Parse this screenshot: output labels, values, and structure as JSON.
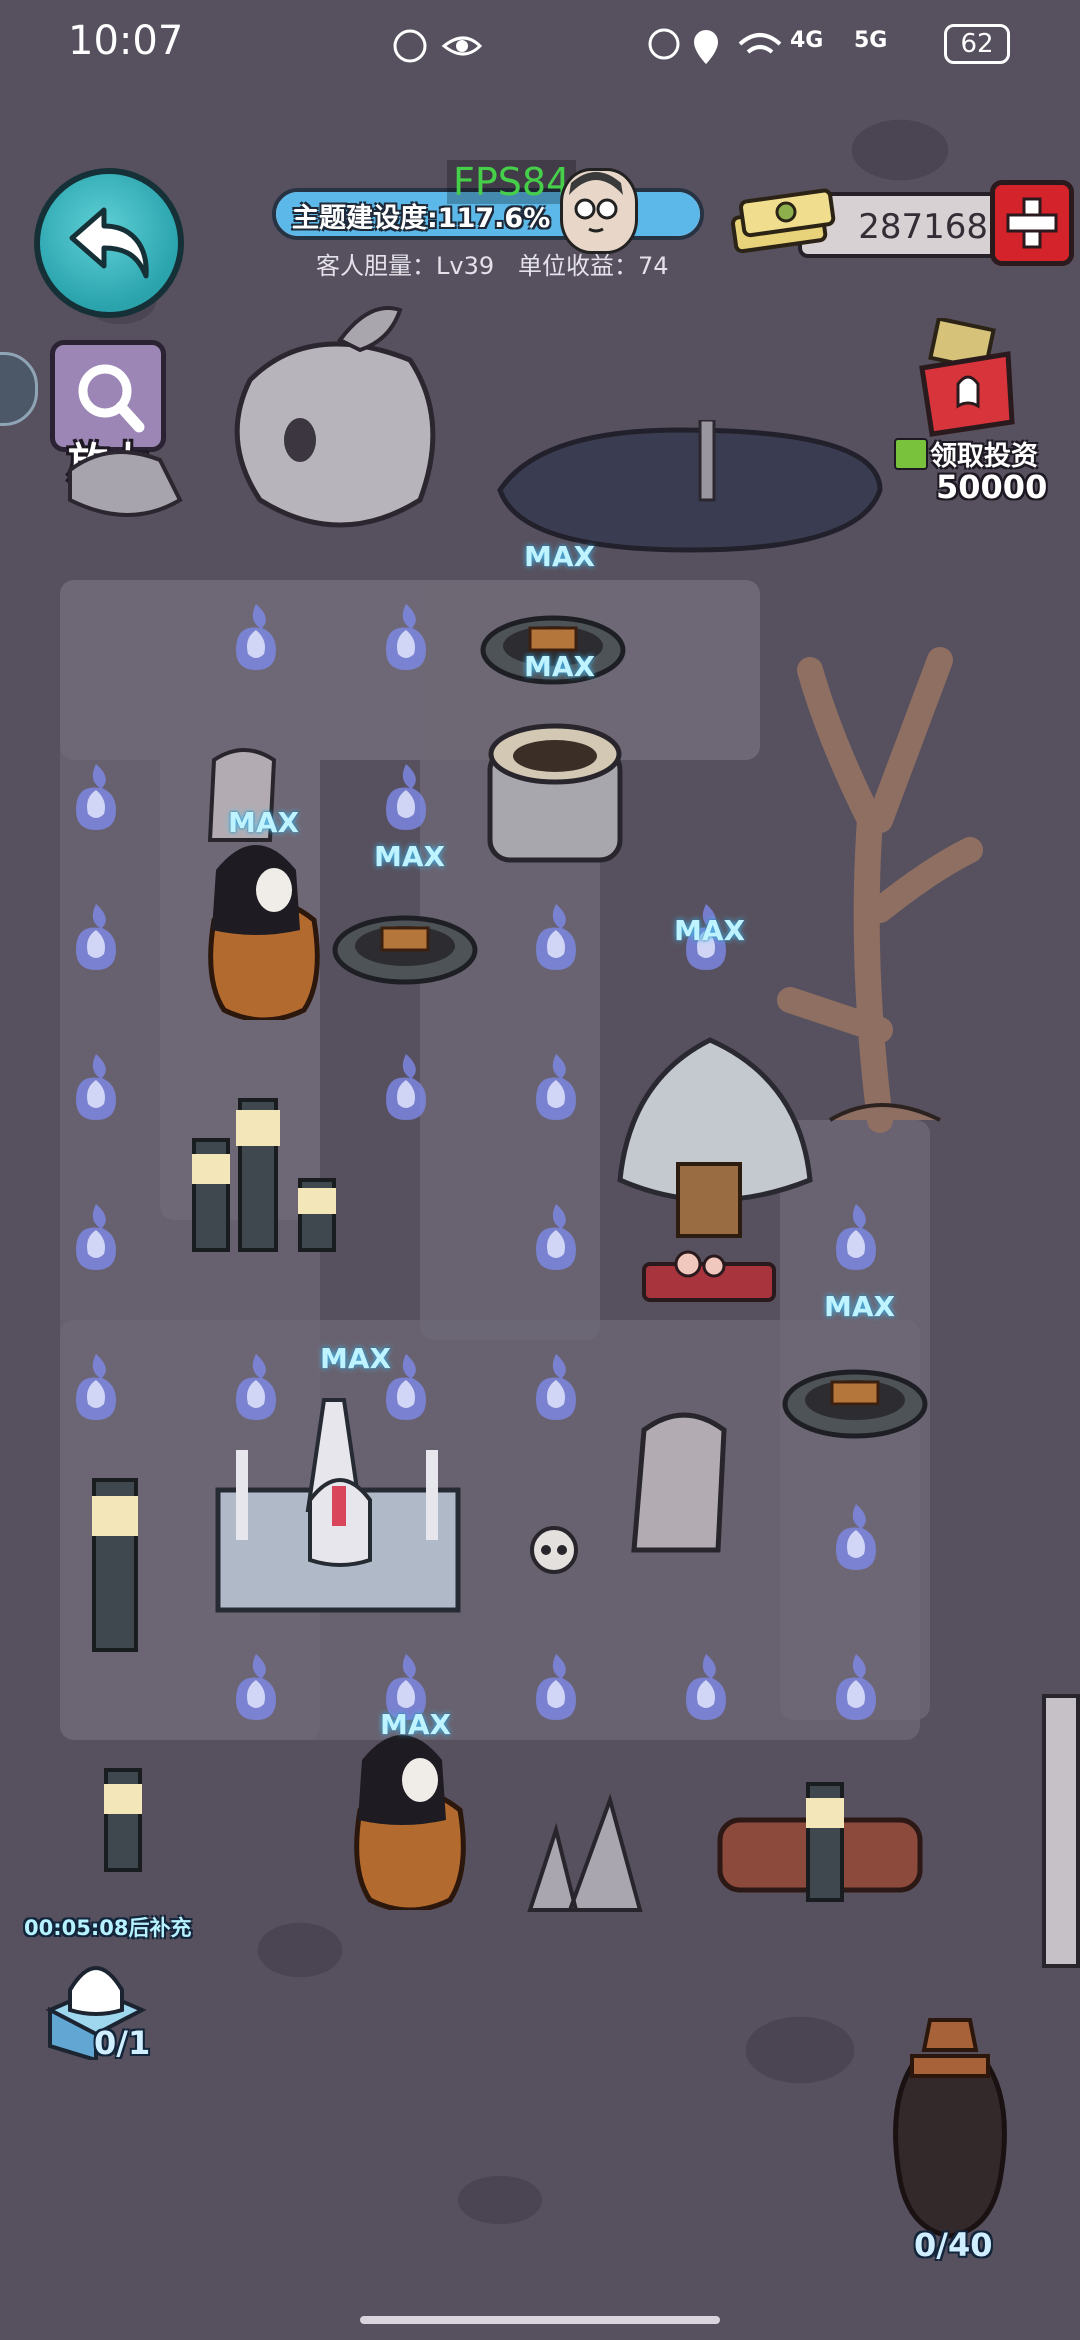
{
  "status_bar": {
    "time": "10:07",
    "network_4g": "4G",
    "network_5g": "5G",
    "battery": "62"
  },
  "hud": {
    "fps": "FPS84",
    "theme_progress_label": "主题建设度:117.6%",
    "theme_progress": 1.0,
    "guest_courage": "客人胆量：Lv39",
    "unit_income": "单位收益：74",
    "money": "287168",
    "zoom_label": "放大",
    "invest_label": "领取投资",
    "invest_amount": "50000",
    "refill_timer": "00:05:08后补充",
    "ghost_box_count": "0/1",
    "urn_count": "0/40"
  },
  "map": {
    "max_label": "MAX"
  },
  "colors": {
    "ghost_flame": "#7f8cf0",
    "max_text": "#bff3ff",
    "accent_teal": "#2aa3ad",
    "progress_blue": "#5bb8e8",
    "add_red": "#d4232a"
  }
}
